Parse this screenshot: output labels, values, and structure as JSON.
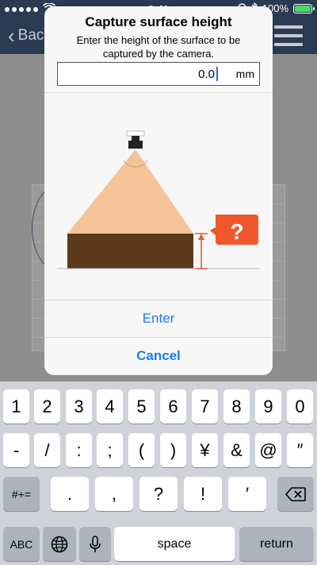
{
  "status_bar": {
    "time": "9:41",
    "battery_percent": "100%",
    "battery_level": 1.0
  },
  "background_nav": {
    "back_label": "Back"
  },
  "dialog": {
    "title": "Capture surface height",
    "message": "Enter the height of the surface to be captured by the camera.",
    "input_value": "0.0",
    "unit": "mm",
    "illustration_badge": "?",
    "enter_label": "Enter",
    "cancel_label": "Cancel"
  },
  "colors": {
    "accent": "#1a7bf2",
    "cone": "#f5c398",
    "surface": "#5a3a1a",
    "arrow": "#e8563a",
    "badge": "#f0572a"
  },
  "keyboard": {
    "row1": [
      "1",
      "2",
      "3",
      "4",
      "5",
      "6",
      "7",
      "8",
      "9",
      "0"
    ],
    "row2": [
      "-",
      "/",
      ":",
      ";",
      "(",
      ")",
      "¥",
      "&",
      "@",
      "″"
    ],
    "row3": [
      ".",
      ",",
      "?",
      "!",
      "′"
    ],
    "shift_label": "#+=",
    "abc_label": "ABC",
    "space_label": "space",
    "return_label": "return"
  }
}
